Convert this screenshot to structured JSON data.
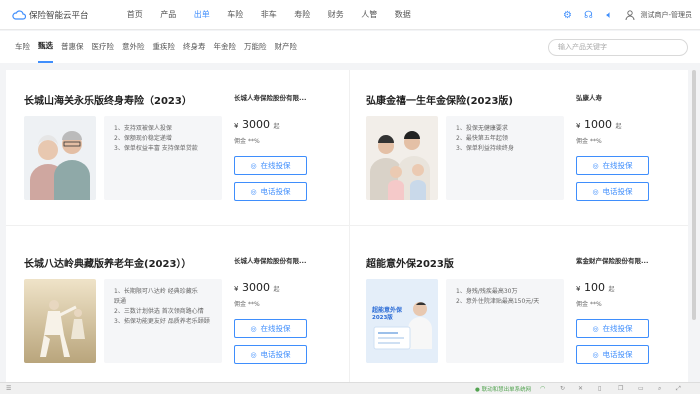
{
  "topbar": {
    "brand": "保险智能云平台",
    "nav": [
      "首页",
      "产品",
      "出单",
      "车险",
      "非车",
      "寿险",
      "财务",
      "人管",
      "数据"
    ],
    "active_nav": "出单",
    "user": "测试商户-管理员",
    "accent": "#3f8efc"
  },
  "tabs": {
    "items": [
      "车险",
      "甄选",
      "普惠保",
      "医疗险",
      "意外险",
      "重疾险",
      "终身寿",
      "年金险",
      "万能险",
      "财产险"
    ],
    "active": "甄选",
    "search_placeholder": "输入产品关键字"
  },
  "cards": [
    {
      "title": "长城山海关永乐版终身寿险（2023）",
      "company": "长城人寿保险股份有限...",
      "features": [
        "1、支持双被保人投保",
        "2、保额现价稳定递增",
        "3、保单权益丰富 支持保单贷款"
      ],
      "currency": "¥",
      "price": "3000",
      "price_unit": "起",
      "rate_label": "佣金",
      "rate": "**%",
      "btn_online": "在线投保",
      "btn_phone": "电话投保",
      "photo_icon": "elderly-couple-photo"
    },
    {
      "title": "弘康金禧一生年金保险(2023版)",
      "company": "弘康人寿",
      "features": [
        "1、投保无健康要求",
        "2、最快第五年起领",
        "3、保单利益持续终身"
      ],
      "currency": "¥",
      "price": "1000",
      "price_unit": "起",
      "rate_label": "佣金",
      "rate": "**%",
      "btn_online": "在线投保",
      "btn_phone": "电话投保",
      "photo_icon": "family-photo"
    },
    {
      "title": "长城八达岭典藏版养老年金(2023））",
      "company": "长城人寿保险股份有限...",
      "features": [
        "1、长期限可八达岭 经典珍藏乐",
        "跃通",
        "2、三数计划供选 首次领商路心情",
        "3、拓保功能更友好 品质养老乐颐颐"
      ],
      "currency": "¥",
      "price": "3000",
      "price_unit": "起",
      "rate_label": "佣金",
      "rate": "**%",
      "btn_online": "在线投保",
      "btn_phone": "电话投保",
      "photo_icon": "taichi-photo"
    },
    {
      "title": "超能意外保2023版",
      "company": "紫金财产保险股份有限...",
      "features": [
        "1、身残/残疾最高30万",
        "2、意外住院津贴最高150元/天"
      ],
      "currency": "¥",
      "price": "100",
      "price_unit": "起",
      "rate_label": "佣金",
      "rate": "**%",
      "btn_online": "在线投保",
      "btn_phone": "电话投保",
      "photo_icon": "accident-insurance-poster",
      "poster_title": "超能意外保",
      "poster_sub": "2023版"
    }
  ],
  "statusbar": {
    "network": "联动和慧出单系统网"
  }
}
